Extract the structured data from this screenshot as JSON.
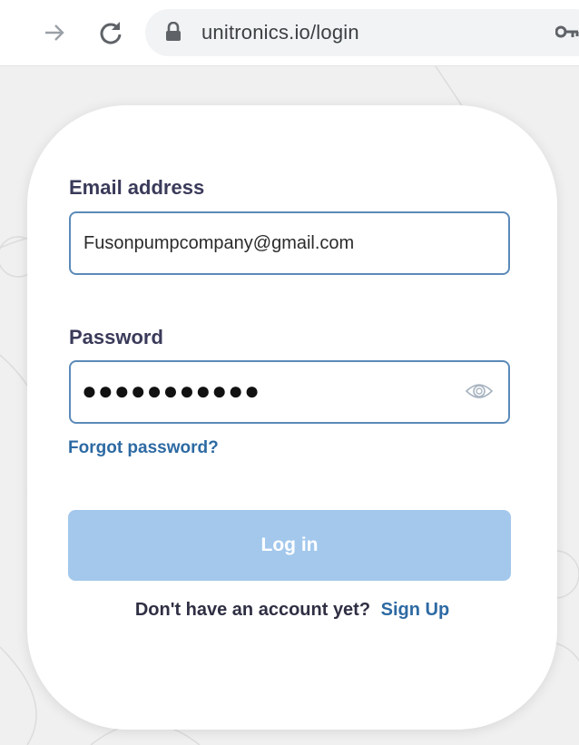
{
  "browser": {
    "url": "unitronics.io/login",
    "icons": {
      "forward": "forward-arrow-icon",
      "reload": "reload-icon",
      "lock": "lock-icon",
      "key": "key-icon"
    }
  },
  "login_form": {
    "email_label": "Email address",
    "email_value": "Fusonpumpcompany@gmail.com",
    "password_label": "Password",
    "password_masked": "●●●●●●●●●●●",
    "show_password_icon": "eye-icon",
    "forgot_password": "Forgot password?",
    "login_button": "Log in",
    "signup_prompt": "Don't have an account yet?",
    "signup_link": "Sign Up"
  },
  "colors": {
    "accent_link": "#2d6aa3",
    "input_border": "#5b8ab8",
    "button_disabled": "#a3c8ec",
    "label_text": "#3a3a5a"
  }
}
